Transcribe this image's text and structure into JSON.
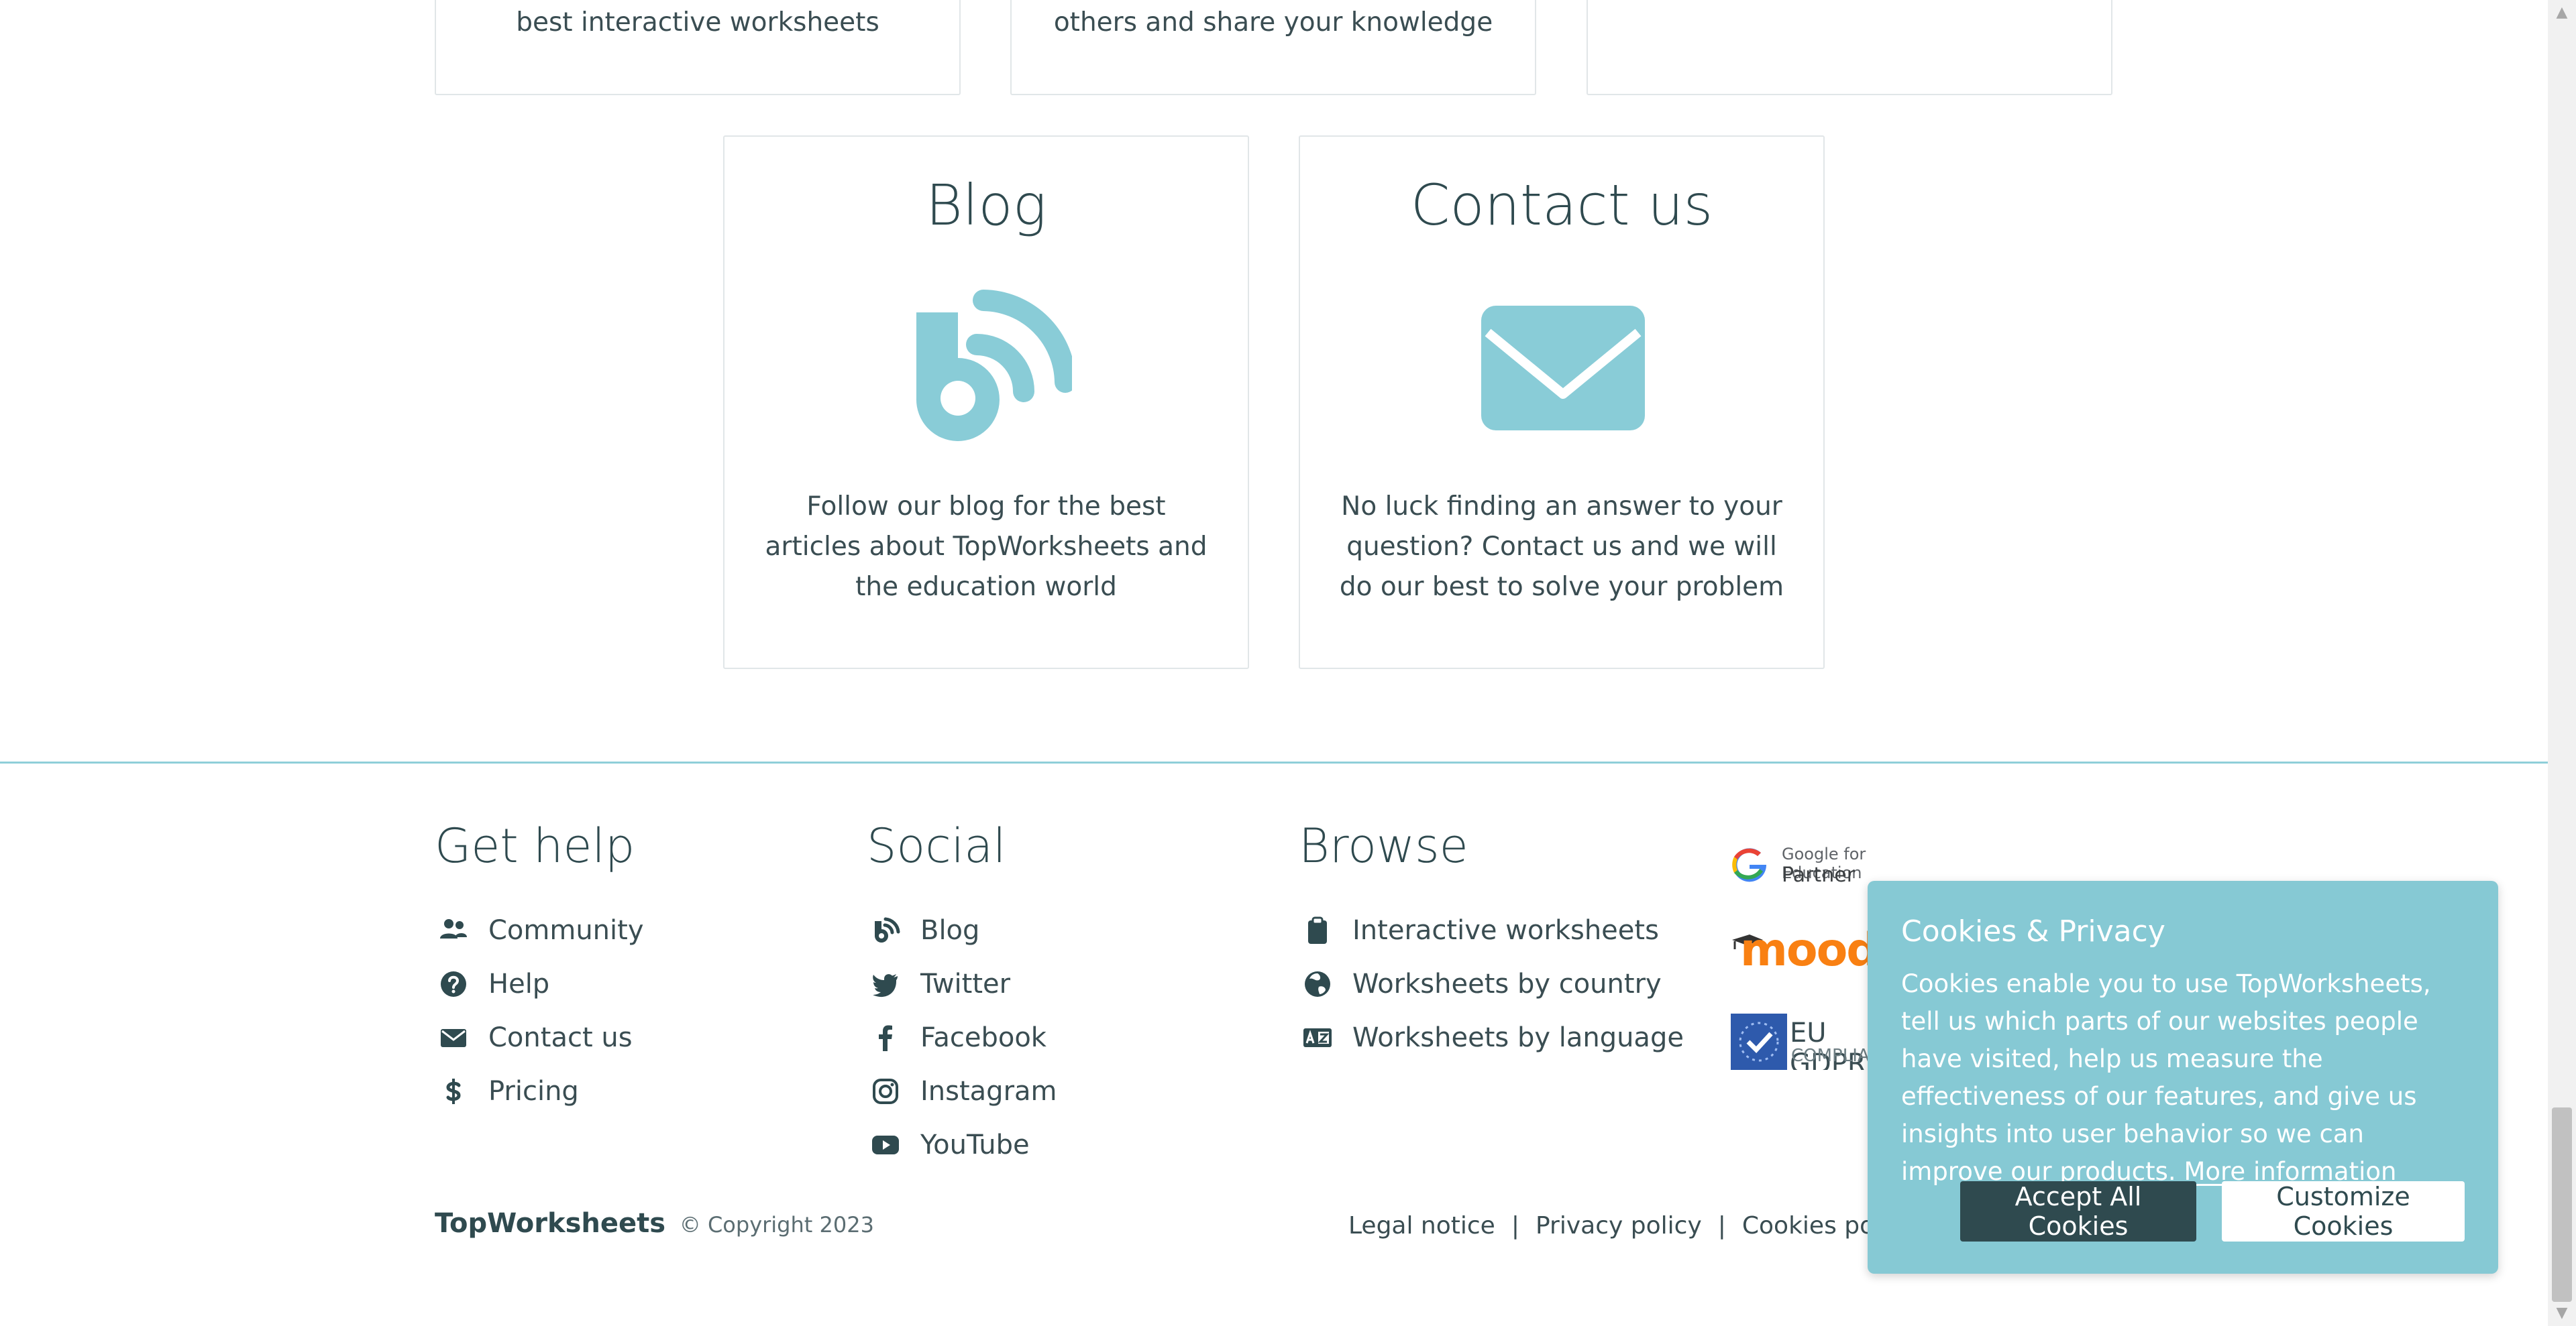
{
  "top_cards": [
    {
      "text": "best interactive worksheets"
    },
    {
      "text": "others and share your knowledge"
    },
    {
      "text": ""
    }
  ],
  "cards": {
    "blog": {
      "title": "Blog",
      "text": "Follow our blog for the best articles about TopWorksheets and the education world",
      "icon": "blog-icon",
      "color": "#89ccd7"
    },
    "contact": {
      "title": "Contact us",
      "text": "No luck finding an answer to your question? Contact us and we will do our best to solve your problem",
      "icon": "envelope-icon",
      "color": "#89ccd7"
    }
  },
  "footer": {
    "get_help": {
      "title": "Get help",
      "items": [
        {
          "label": "Community",
          "icon": "users-icon"
        },
        {
          "label": "Help",
          "icon": "question-circle-icon"
        },
        {
          "label": "Contact us",
          "icon": "envelope-icon"
        },
        {
          "label": "Pricing",
          "icon": "dollar-icon"
        }
      ]
    },
    "social": {
      "title": "Social",
      "items": [
        {
          "label": "Blog",
          "icon": "blog-icon"
        },
        {
          "label": "Twitter",
          "icon": "twitter-icon"
        },
        {
          "label": "Facebook",
          "icon": "facebook-icon"
        },
        {
          "label": "Instagram",
          "icon": "instagram-icon"
        },
        {
          "label": "YouTube",
          "icon": "youtube-icon"
        }
      ]
    },
    "browse": {
      "title": "Browse",
      "items": [
        {
          "label": "Interactive worksheets",
          "icon": "clipboard-icon"
        },
        {
          "label": "Worksheets by country",
          "icon": "globe-icon"
        },
        {
          "label": "Worksheets by language",
          "icon": "language-icon"
        }
      ]
    },
    "partners": {
      "google_line1": "Google for Education",
      "google_line2": "Partner",
      "moodle": "moodle",
      "gdpr_line1": "EU GDPR",
      "gdpr_line2": "COMPLIANT"
    },
    "brand": "TopWorksheets",
    "copyright": "© Copyright 2023",
    "legal": [
      "Legal notice",
      "Privacy policy",
      "Cookies policy"
    ]
  },
  "cookie_banner": {
    "title": "Cookies & Privacy",
    "text": "Cookies enable you to use TopWorksheets, tell us which parts of our websites people have visited, help us measure the effectiveness of our features, and give us insights into user behavior so we can improve our products.",
    "more": "More information",
    "accept": "Accept All Cookies",
    "customize": "Customize Cookies",
    "bg_color": "#86c9d4"
  }
}
